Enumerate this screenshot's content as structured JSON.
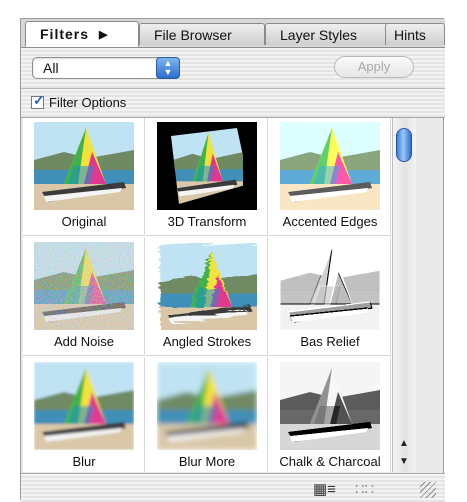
{
  "tabs": [
    {
      "label": "Filters",
      "active": true
    },
    {
      "label": "File Browser",
      "active": false
    },
    {
      "label": "Layer Styles",
      "active": false
    },
    {
      "label": "Hints",
      "active": false
    }
  ],
  "category_select": {
    "value": "All",
    "stepper_icon": "up-down-arrows-icon"
  },
  "apply_button": {
    "label": "Apply",
    "enabled": false
  },
  "filter_options": {
    "label": "Filter Options",
    "checked": true
  },
  "filters": [
    {
      "label": "Original",
      "style": "original"
    },
    {
      "label": "3D Transform",
      "style": "transform"
    },
    {
      "label": "Accented Edges",
      "style": "accented"
    },
    {
      "label": "Add Noise",
      "style": "noise"
    },
    {
      "label": "Angled Strokes",
      "style": "strokes"
    },
    {
      "label": "Bas Relief",
      "style": "relief"
    },
    {
      "label": "Blur",
      "style": "blur"
    },
    {
      "label": "Blur More",
      "style": "blurmore"
    },
    {
      "label": "Chalk & Charcoal",
      "style": "chalk"
    }
  ],
  "view_icons": [
    "list-view-icon",
    "grid-view-icon"
  ],
  "colors": {
    "scroll_thumb": "#3a7fd8",
    "sail_yellow": "#f2e23a",
    "sail_pink": "#e2378f",
    "sail_green": "#3fb24a",
    "sea": "#3f8fb8"
  }
}
